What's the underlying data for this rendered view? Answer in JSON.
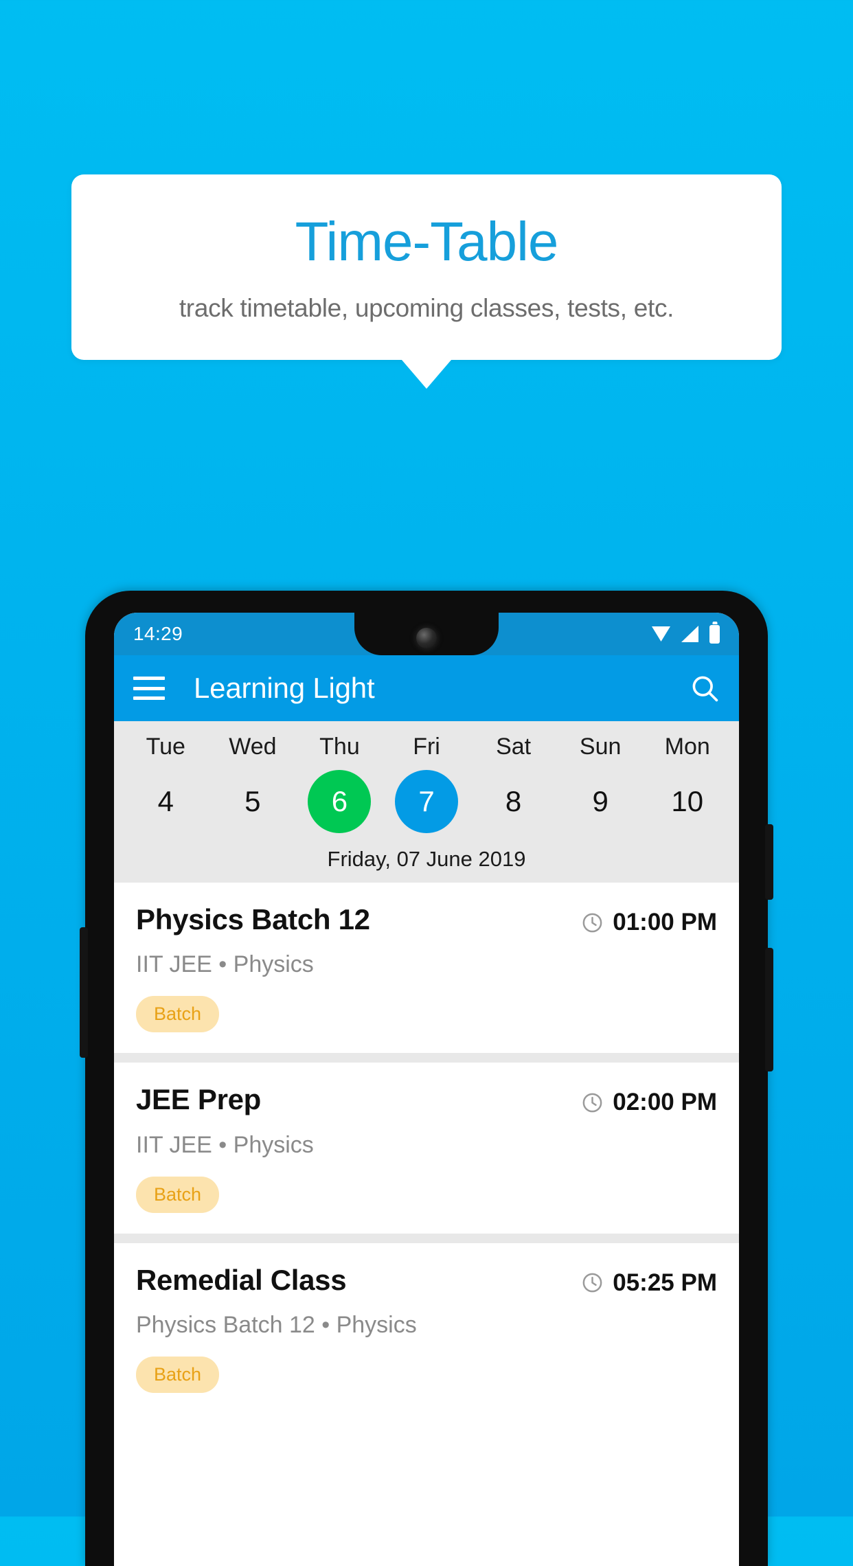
{
  "promo": {
    "title": "Time-Table",
    "subtitle": "track timetable, upcoming classes, tests, etc.",
    "title_color": "#169FDB",
    "background_color": "#00B3EE"
  },
  "statusbar": {
    "time": "14:29",
    "icons": [
      "wifi-icon",
      "signal-icon",
      "battery-icon"
    ]
  },
  "appbar": {
    "menu_icon": "hamburger-menu-icon",
    "title": "Learning Light",
    "search_icon": "search-icon",
    "background_color": "#039BE5"
  },
  "calendar": {
    "days": [
      {
        "name": "Tue",
        "number": "4",
        "state": "normal"
      },
      {
        "name": "Wed",
        "number": "5",
        "state": "normal"
      },
      {
        "name": "Thu",
        "number": "6",
        "state": "today"
      },
      {
        "name": "Fri",
        "number": "7",
        "state": "selected"
      },
      {
        "name": "Sat",
        "number": "8",
        "state": "normal"
      },
      {
        "name": "Sun",
        "number": "9",
        "state": "normal"
      },
      {
        "name": "Mon",
        "number": "10",
        "state": "normal"
      }
    ],
    "selected_date_label": "Friday, 07 June 2019",
    "today_color": "#00C853",
    "selected_color": "#039BE5"
  },
  "classes": [
    {
      "title": "Physics Batch 12",
      "time": "01:00 PM",
      "subtitle": "IIT JEE • Physics",
      "badge": "Batch",
      "clock_icon": "clock-icon"
    },
    {
      "title": "JEE Prep",
      "time": "02:00 PM",
      "subtitle": "IIT JEE • Physics",
      "badge": "Batch",
      "clock_icon": "clock-icon"
    },
    {
      "title": "Remedial Class",
      "time": "05:25 PM",
      "subtitle": "Physics Batch 12 • Physics",
      "badge": "Batch",
      "clock_icon": "clock-icon"
    }
  ],
  "badge_colors": {
    "background": "#FCE3AE",
    "text": "#E8A116"
  }
}
